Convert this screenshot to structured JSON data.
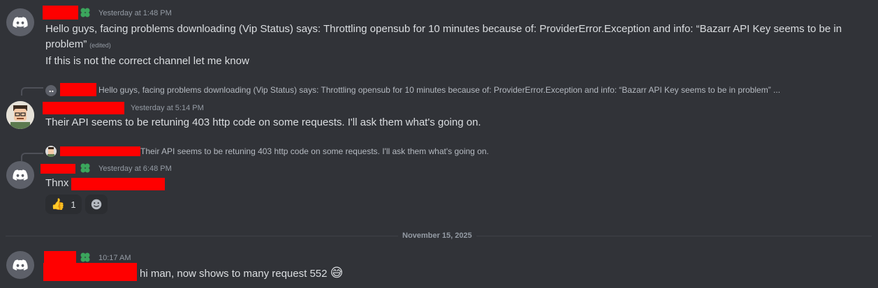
{
  "messages": [
    {
      "timestamp": "Yesterday at 1:48 PM",
      "line1": "Hello guys, facing problems downloading (Vip Status) says: Throttling opensub for 10 minutes because of: ProviderError.Exception and info: “Bazarr API Key seems to be in",
      "line2": "problem”",
      "edited": "(edited)",
      "followup": "If this is not the correct channel let me know"
    },
    {
      "reply_preview": "Hello guys, facing problems downloading (Vip Status) says: Throttling opensub for 10 minutes because of: ProviderError.Exception and info: “Bazarr API Key seems to be in problem” ...",
      "timestamp": "Yesterday at 5:14 PM",
      "text": "Their API seems to be retuning 403 http code on some requests. I'll ask them what's going on."
    },
    {
      "reply_preview": "Their API seems to be retuning 403 http code on some requests. I'll ask them what's going on.",
      "timestamp": "Yesterday at 6:48 PM",
      "text": "Thnx",
      "reactions": [
        {
          "emoji": "👍",
          "count": "1"
        }
      ]
    },
    {
      "timestamp": "10:17 AM",
      "text": "hi man, now shows to many request 552",
      "emoji": "😅"
    }
  ],
  "date_divider": "November 15, 2025",
  "icons": {
    "avatar": "discord-logo-icon",
    "badge": "clover-badge-icon",
    "add_reaction": "add-reaction-icon"
  },
  "colors": {
    "background": "#313338",
    "redaction": "#ff0000",
    "badge": "#3ba55c"
  }
}
